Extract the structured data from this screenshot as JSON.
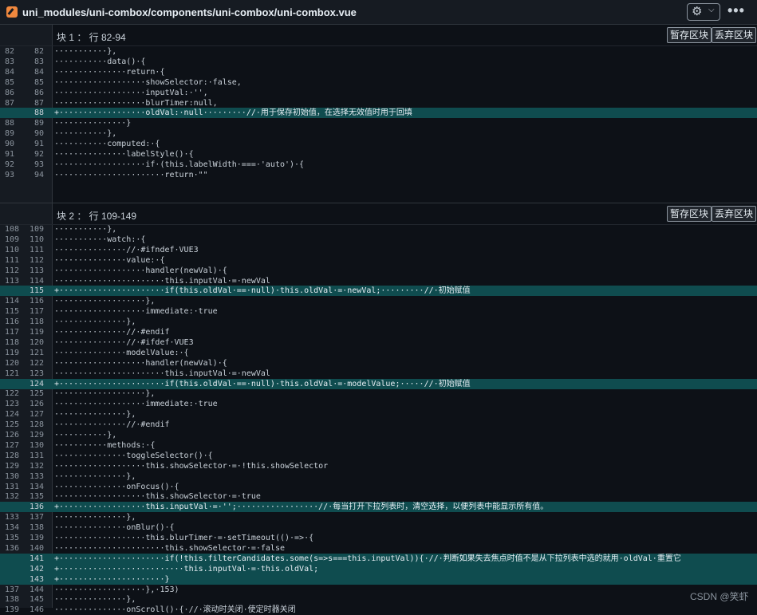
{
  "header": {
    "file_path": "uni_modules/uni-combox/components/uni-combox/uni-combox.vue",
    "settings_icon": "gear-icon",
    "settings_glyph": "⚙",
    "dropdown_glyph": "⌵",
    "more_glyph": "•••"
  },
  "hunks": [
    {
      "title": "块 1 ： 行 82-94",
      "stage_label": "暂存区块",
      "discard_label": "丢弃区块",
      "lines": [
        {
          "old": "82",
          "new": "82",
          "added": false,
          "text": "···········},"
        },
        {
          "old": "83",
          "new": "83",
          "added": false,
          "text": "···········data()·{"
        },
        {
          "old": "84",
          "new": "84",
          "added": false,
          "text": "···············return·{"
        },
        {
          "old": "85",
          "new": "85",
          "added": false,
          "text": "···················showSelector:·false,"
        },
        {
          "old": "86",
          "new": "86",
          "added": false,
          "text": "···················inputVal:·'',"
        },
        {
          "old": "87",
          "new": "87",
          "added": false,
          "text": "···················blurTimer:null,"
        },
        {
          "old": "",
          "new": "88",
          "added": true,
          "text": "+··················oldVal:·null·········//·用于保存初始值，在选择无效值时用于回填"
        },
        {
          "old": "88",
          "new": "89",
          "added": false,
          "text": "···············}"
        },
        {
          "old": "89",
          "new": "90",
          "added": false,
          "text": "···········},"
        },
        {
          "old": "90",
          "new": "91",
          "added": false,
          "text": "···········computed:·{"
        },
        {
          "old": "91",
          "new": "92",
          "added": false,
          "text": "···············labelStyle()·{"
        },
        {
          "old": "92",
          "new": "93",
          "added": false,
          "text": "···················if·(this.labelWidth·===·'auto')·{"
        },
        {
          "old": "93",
          "new": "94",
          "added": false,
          "text": "·······················return·\"\""
        }
      ]
    },
    {
      "title": "块 2 ： 行 109-149",
      "stage_label": "暂存区块",
      "discard_label": "丢弃区块",
      "lines": [
        {
          "old": "108",
          "new": "109",
          "added": false,
          "text": "···········},"
        },
        {
          "old": "109",
          "new": "110",
          "added": false,
          "text": "···········watch:·{"
        },
        {
          "old": "110",
          "new": "111",
          "added": false,
          "text": "···············//·#ifndef·VUE3"
        },
        {
          "old": "111",
          "new": "112",
          "added": false,
          "text": "···············value:·{"
        },
        {
          "old": "112",
          "new": "113",
          "added": false,
          "text": "···················handler(newVal)·{"
        },
        {
          "old": "113",
          "new": "114",
          "added": false,
          "text": "·······················this.inputVal·=·newVal"
        },
        {
          "old": "",
          "new": "115",
          "added": true,
          "text": "+······················if(this.oldVal·==·null)·this.oldVal·=·newVal;·········//·初始赋值"
        },
        {
          "old": "114",
          "new": "116",
          "added": false,
          "text": "···················},"
        },
        {
          "old": "115",
          "new": "117",
          "added": false,
          "text": "···················immediate:·true"
        },
        {
          "old": "116",
          "new": "118",
          "added": false,
          "text": "···············},"
        },
        {
          "old": "117",
          "new": "119",
          "added": false,
          "text": "···············//·#endif"
        },
        {
          "old": "118",
          "new": "120",
          "added": false,
          "text": "···············//·#ifdef·VUE3"
        },
        {
          "old": "119",
          "new": "121",
          "added": false,
          "text": "···············modelValue:·{"
        },
        {
          "old": "120",
          "new": "122",
          "added": false,
          "text": "···················handler(newVal)·{"
        },
        {
          "old": "121",
          "new": "123",
          "added": false,
          "text": "·······················this.inputVal·=·newVal"
        },
        {
          "old": "",
          "new": "124",
          "added": true,
          "text": "+······················if(this.oldVal·==·null)·this.oldVal·=·modelValue;·····//·初始赋值"
        },
        {
          "old": "122",
          "new": "125",
          "added": false,
          "text": "···················},"
        },
        {
          "old": "123",
          "new": "126",
          "added": false,
          "text": "···················immediate:·true"
        },
        {
          "old": "124",
          "new": "127",
          "added": false,
          "text": "···············},"
        },
        {
          "old": "125",
          "new": "128",
          "added": false,
          "text": "···············//·#endif"
        },
        {
          "old": "126",
          "new": "129",
          "added": false,
          "text": "···········},"
        },
        {
          "old": "127",
          "new": "130",
          "added": false,
          "text": "···········methods:·{"
        },
        {
          "old": "128",
          "new": "131",
          "added": false,
          "text": "···············toggleSelector()·{"
        },
        {
          "old": "129",
          "new": "132",
          "added": false,
          "text": "···················this.showSelector·=·!this.showSelector"
        },
        {
          "old": "130",
          "new": "133",
          "added": false,
          "text": "···············},"
        },
        {
          "old": "131",
          "new": "134",
          "added": false,
          "text": "···············onFocus()·{"
        },
        {
          "old": "132",
          "new": "135",
          "added": false,
          "text": "···················this.showSelector·=·true"
        },
        {
          "old": "",
          "new": "136",
          "added": true,
          "text": "+··················this.inputVal·=·'';·················//·每当打开下拉列表时，清空选择，以便列表中能显示所有值。"
        },
        {
          "old": "133",
          "new": "137",
          "added": false,
          "text": "···············},"
        },
        {
          "old": "134",
          "new": "138",
          "added": false,
          "text": "···············onBlur()·{"
        },
        {
          "old": "135",
          "new": "139",
          "added": false,
          "text": "···················this.blurTimer·=·setTimeout(()·=>·{"
        },
        {
          "old": "136",
          "new": "140",
          "added": false,
          "text": "·······················this.showSelector·=·false"
        },
        {
          "old": "",
          "new": "141",
          "added": true,
          "text": "+······················if(!this.filterCandidates.some(s=>s===this.inputVal)){·//·判断如果失去焦点时值不是从下拉列表中选的就用·oldVal·重置它"
        },
        {
          "old": "",
          "new": "142",
          "added": true,
          "text": "+··························this.inputVal·=·this.oldVal;"
        },
        {
          "old": "",
          "new": "143",
          "added": true,
          "text": "+······················}"
        },
        {
          "old": "137",
          "new": "144",
          "added": false,
          "text": "···················},·153)"
        },
        {
          "old": "138",
          "new": "145",
          "added": false,
          "text": "···············},"
        },
        {
          "old": "139",
          "new": "146",
          "added": false,
          "text": "···············onScroll()·{·//·滚动时关闭·使定时器关闭"
        }
      ]
    }
  ],
  "watermark": "CSDN @笑虾"
}
